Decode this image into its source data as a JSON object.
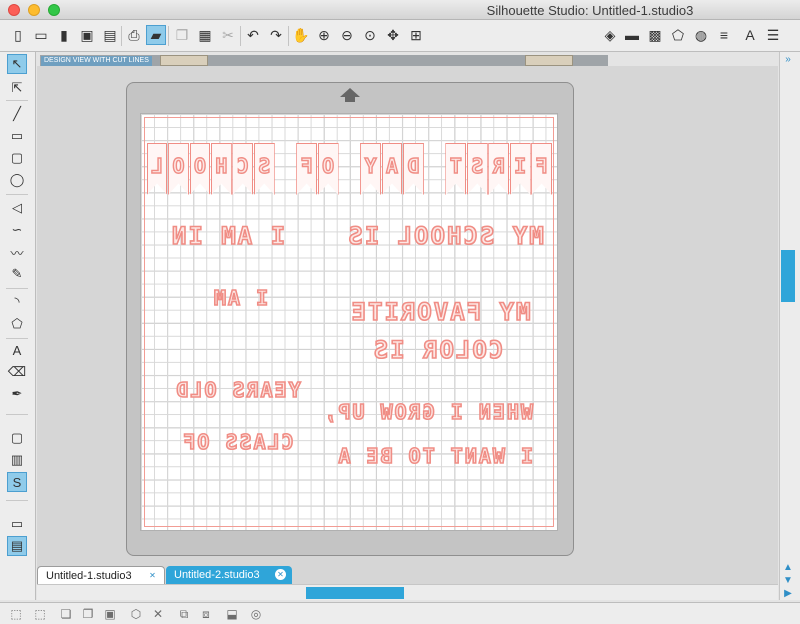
{
  "window": {
    "title": "Silhouette Studio: Untitled-1.studio3"
  },
  "toolbar": {
    "icons": [
      "new-document-icon",
      "open-icon",
      "device-icon",
      "save-icon",
      "save-as-icon",
      "print-icon",
      "send-to-cutter-icon",
      "copy-icon",
      "paste-icon",
      "cut-icon",
      "undo-icon",
      "redo-icon",
      "pan-hand-icon",
      "zoom-in-icon",
      "zoom-out-icon",
      "zoom-select-icon",
      "zoom-fit-icon",
      "fit-to-page-icon",
      "fill-icon",
      "line-color-icon",
      "fill-pattern-icon",
      "shape-icon",
      "gradient-icon",
      "line-style-icon",
      "text-style-icon",
      "align-icon"
    ],
    "text_style_glyph": "A"
  },
  "design_view": {
    "label": "DESIGN VIEW WITH CUT LINES"
  },
  "artwork": {
    "banner_letters": [
      "F",
      "I",
      "R",
      "S",
      "T",
      "",
      "D",
      "A",
      "Y",
      "",
      "O",
      "F",
      "",
      "S",
      "C",
      "H",
      "O",
      "O",
      "L"
    ],
    "line1": "MY SCHOOL IS",
    "line2": "I AM IN",
    "line3": "I AM",
    "line4a": "MY FAVORITE",
    "line4b": "COLOR IS",
    "line5": "YEARS OLD",
    "line6a": "WHEN I GROW UP,",
    "line6b": "I WANT TO BE A",
    "line7": "CLASS OF"
  },
  "tabs": [
    {
      "label": "Untitled-1.studio3",
      "active": false
    },
    {
      "label": "Untitled-2.studio3",
      "active": true
    }
  ],
  "colors": {
    "accent": "#2fa5d9",
    "cut_line": "#f08d85"
  }
}
